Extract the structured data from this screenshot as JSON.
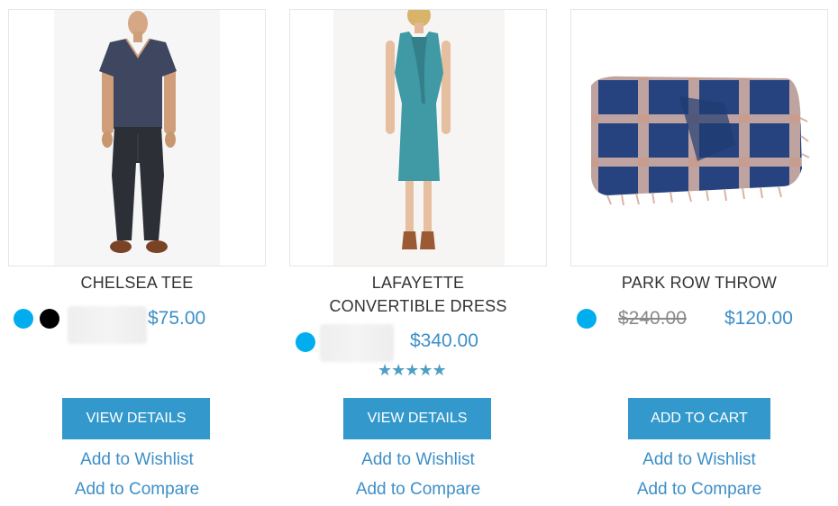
{
  "products": [
    {
      "name": "CHELSEA TEE",
      "swatches": [
        "#00aef0",
        "#000000"
      ],
      "price": "$75.00",
      "button_label": "VIEW DETAILS",
      "wishlist_label": "Add to Wishlist",
      "compare_label": "Add to Compare",
      "image": "man-in-navy-v-neck-tee-and-jeans"
    },
    {
      "name": "LAFAYETTE CONVERTIBLE DRESS",
      "swatches": [
        "#00aef0"
      ],
      "price": "$340.00",
      "rating_stars": "★★★★★",
      "rating_value": 5,
      "rating_max": 5,
      "button_label": "VIEW DETAILS",
      "wishlist_label": "Add to Wishlist",
      "compare_label": "Add to Compare",
      "image": "woman-in-teal-dress"
    },
    {
      "name": "PARK ROW THROW",
      "swatches": [
        "#00aef0"
      ],
      "old_price": "$240.00",
      "price": "$120.00",
      "button_label": "ADD TO CART",
      "wishlist_label": "Add to Wishlist",
      "compare_label": "Add to Compare",
      "image": "blue-and-beige-plaid-throw"
    }
  ],
  "colors": {
    "accent_button": "#3399cc",
    "price": "#3d8fc8",
    "link": "#3d8fc8",
    "star": "#4e9fc3"
  }
}
